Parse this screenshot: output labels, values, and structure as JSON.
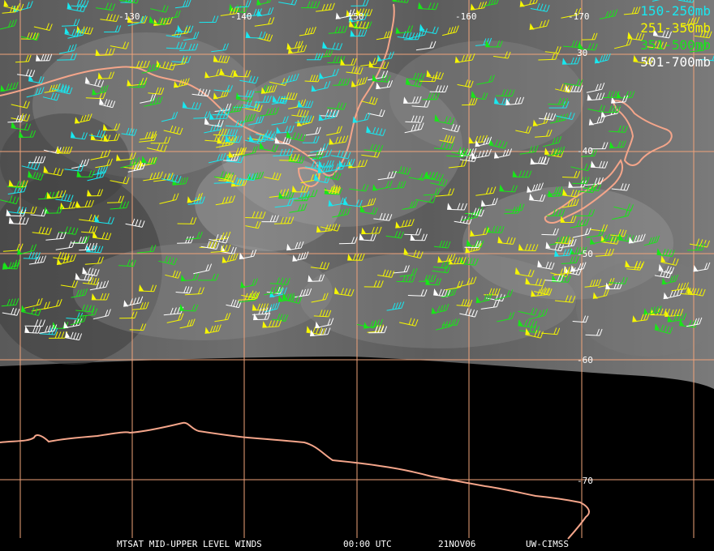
{
  "map": {
    "longitude_labels": [
      "-130",
      "-140",
      "-150",
      "-160",
      "-170"
    ],
    "latitude_labels": [
      "30",
      "-40",
      "-50",
      "-60",
      "-70"
    ],
    "colors": {
      "grid": "#f0a37a",
      "coast": "#f4a58a",
      "earth_night": "#000000",
      "cloud_dark": "#3a3a3a",
      "cloud_light": "#b0b0b0"
    }
  },
  "legend": [
    {
      "label": "150-250mb",
      "color": "#18e8f0"
    },
    {
      "label": "251-350mb",
      "color": "#f6f600"
    },
    {
      "label": "351-500mb",
      "color": "#19e619"
    },
    {
      "label": "501-700mb",
      "color": "#ffffff"
    }
  ],
  "footer": {
    "product": "MTSAT MID-UPPER LEVEL WINDS",
    "time": "00:00 UTC",
    "date": "21NOV06",
    "credit": "UW-CIMSS"
  }
}
